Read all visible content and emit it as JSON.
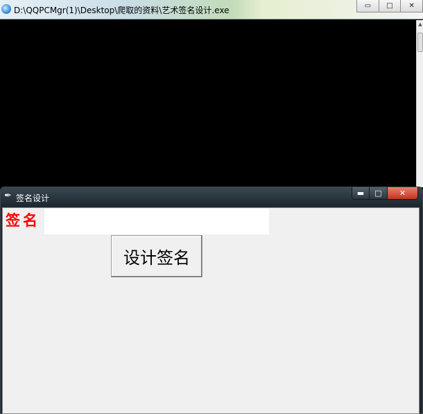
{
  "console_window": {
    "title": "D:\\QQPCMgr(1)\\Desktop\\爬取的资料\\艺术签名设计.exe",
    "controls": {
      "minimize": "▭",
      "maximize": "□",
      "close": "✕"
    }
  },
  "tk_window": {
    "title": "签名设计",
    "controls": {
      "minimize": "▬",
      "maximize": "□",
      "close": "✕"
    },
    "label": "签名",
    "input_value": "",
    "button_label": "设计签名"
  },
  "colors": {
    "label_red": "#ff0000",
    "client_bg": "#f0f0f0",
    "console_bg": "#000000",
    "close_red": "#c2351f"
  },
  "icons": {
    "console_icon": "app-globe-icon",
    "tk_icon": "feather-icon"
  }
}
